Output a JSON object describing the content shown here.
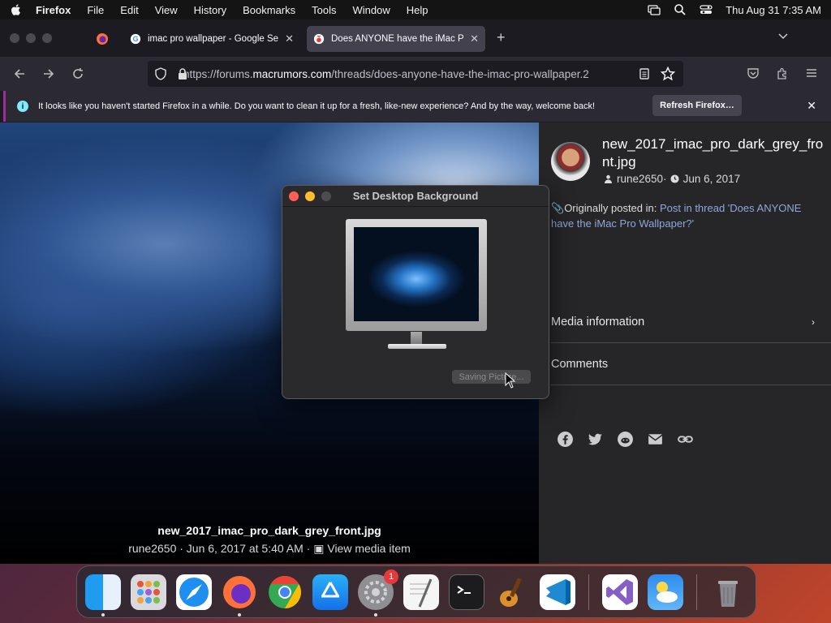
{
  "menubar": {
    "app_name": "Firefox",
    "menus": [
      "File",
      "Edit",
      "View",
      "History",
      "Bookmarks",
      "Tools",
      "Window",
      "Help"
    ],
    "datetime": "Thu Aug 31  7:35 AM"
  },
  "tabs": [
    {
      "title": "imac pro wallpaper - Google Se",
      "favicon": "google-icon",
      "active": false
    },
    {
      "title": "Does ANYONE have the iMac Pr",
      "favicon": "macrumors-icon",
      "active": true
    }
  ],
  "urlbar": {
    "url_prefix": "https://forums.",
    "url_domain": "macrumors.com",
    "url_path": "/threads/does-anyone-have-the-imac-pro-wallpaper.2"
  },
  "notification": {
    "message": "It looks like you haven't started Firefox in a while. Do you want to clean it up for a fresh, like-new experience? And by the way, welcome back!",
    "button_label": "Refresh Firefox…"
  },
  "media": {
    "filename": "new_2017_imac_pro_dark_grey_front.jpg",
    "meta": "rune2650 · Jun 6, 2017 at 5:40 AM · ",
    "view_link": "View media item"
  },
  "sidebar": {
    "title": "new_2017_imac_pro_dark_grey_front.jpg",
    "author": "rune2650",
    "separator": " · ",
    "date": "Jun 6, 2017",
    "posted_label": "Originally posted in: ",
    "posted_link": "Post in thread 'Does ANYONE have the iMac Pro Wallpaper?'",
    "media_info": "Media information",
    "comments": "Comments"
  },
  "dialog": {
    "title": "Set Desktop Background",
    "button_label": "Saving Picture..."
  },
  "dock": {
    "badge_count": "1",
    "apps": [
      "finder-icon",
      "launchpad-icon",
      "safari-icon",
      "firefox-icon",
      "chrome-icon",
      "app-store-icon",
      "system-settings-icon",
      "textedit-icon",
      "terminal-icon",
      "garageband-icon",
      "vscode-icon",
      "visual-studio-icon",
      "weather-icon",
      "trash-icon"
    ]
  }
}
